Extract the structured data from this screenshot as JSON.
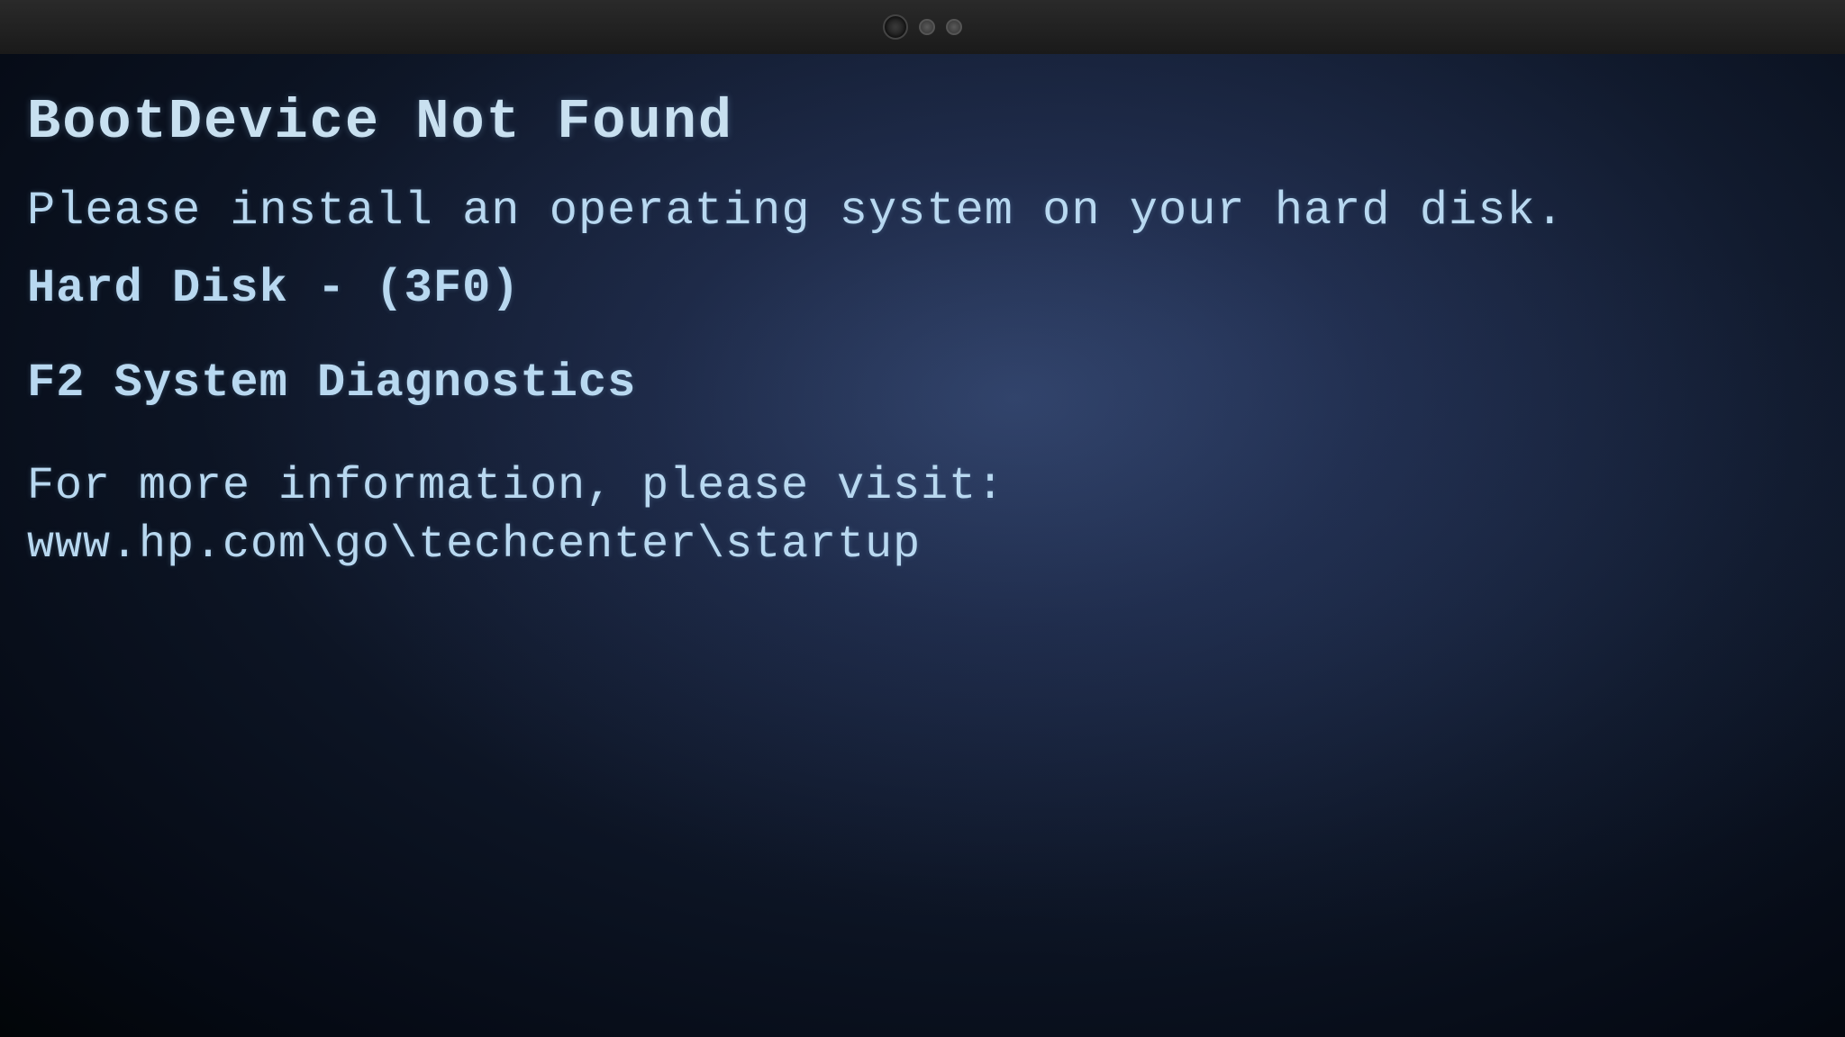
{
  "top_bar": {
    "camera_label": "camera"
  },
  "screen": {
    "title": "BootDevice Not Found",
    "line1": "Please install an operating system on your hard disk.",
    "line2": "Hard Disk - (3F0)",
    "line3": "F2 System Diagnostics",
    "line4_prefix": "For more information, please visit: ",
    "line4_url": "www.hp.com\\go\\techcenter\\startup"
  }
}
